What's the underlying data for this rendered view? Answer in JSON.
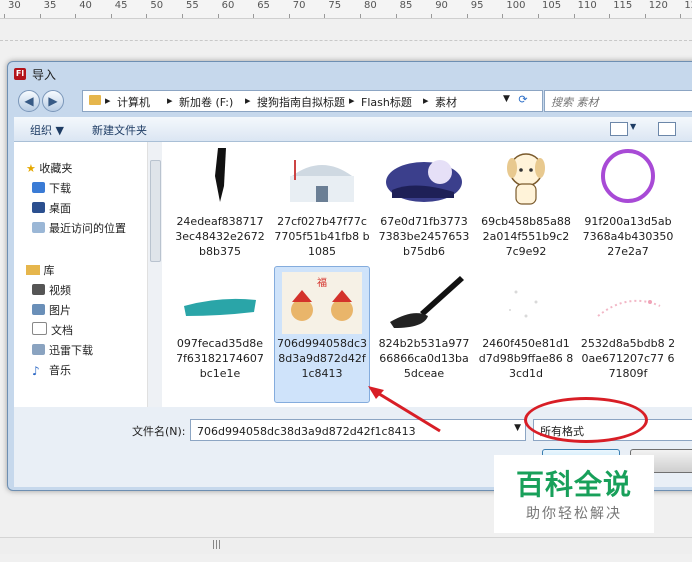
{
  "ruler": {
    "ticks": [
      "30",
      "35",
      "40",
      "45",
      "50",
      "55",
      "60",
      "65",
      "70",
      "75",
      "80",
      "85",
      "90",
      "95",
      "100",
      "105",
      "110",
      "115",
      "120",
      "125"
    ]
  },
  "dialog": {
    "title": "导入",
    "app_icon_text": "Fl",
    "address": {
      "segments": [
        "计算机",
        "新加卷 (F:)",
        "搜狗指南自拟标题",
        "Flash标题",
        "素材"
      ]
    },
    "search_placeholder": "搜索 素材",
    "toolbar": {
      "organize": "组织 ▼",
      "new_folder": "新建文件夹"
    },
    "nav": {
      "favorites_header": "收藏夹",
      "favorites": [
        "下载",
        "桌面",
        "最近访问的位置"
      ],
      "library_header": "库",
      "libraries": [
        "视频",
        "图片",
        "文档",
        "迅雷下载",
        "音乐"
      ]
    },
    "files": [
      {
        "name": "24edeaf838717 3ec48432e2672 b8b375",
        "thumb": "ink"
      },
      {
        "name": "27cf027b47f77c 7705f51b41fb8 b1085",
        "thumb": "house"
      },
      {
        "name": "67e0d71fb3773 7383be2457653 b75db6",
        "thumb": "night"
      },
      {
        "name": "69cb458b85a88 2a014f551b9c2 7c9e92",
        "thumb": "dog"
      },
      {
        "name": "91f200a13d5ab 7368a4b430350 27e2a7",
        "thumb": "circle"
      },
      {
        "name": "097fecad35d8e 7f63182174607 bc1e1e",
        "thumb": "teal"
      },
      {
        "name": "706d994058dc3 8d3a9d872d42f 1c8413",
        "thumb": "kids",
        "selected": true
      },
      {
        "name": "824b2b531a977 66866ca0d13ba 5dceae",
        "thumb": "brush"
      },
      {
        "name": "2460f450e81d1 d7d98b9ffae86 83cd1d",
        "thumb": "dots"
      },
      {
        "name": "2532d8a5bdb8 20ae671207c77 671809f",
        "thumb": "pink"
      }
    ],
    "filename_label": "文件名(N):",
    "filename_value": "706d994058dc38d3a9d872d42f1c8413",
    "format_value": "所有格式"
  },
  "watermark": {
    "title": "百科全说",
    "subtitle": "助你轻松解决"
  },
  "colors": {
    "annotation_red": "#d81e26",
    "watermark_green": "#18a05a"
  }
}
